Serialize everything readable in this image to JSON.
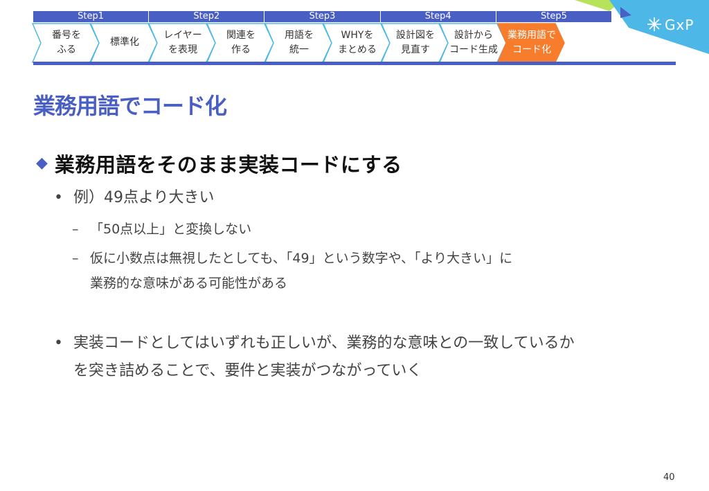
{
  "steps": [
    "Step1",
    "Step2",
    "Step3",
    "Step4",
    "Step5"
  ],
  "process": [
    {
      "line1": "番号を",
      "line2": "ふる"
    },
    {
      "line1": "標準化",
      "line2": ""
    },
    {
      "line1": "レイヤー",
      "line2": "を表現"
    },
    {
      "line1": "関連を",
      "line2": "作る"
    },
    {
      "line1": "用語を",
      "line2": "統一"
    },
    {
      "line1": "WHYを",
      "line2": "まとめる"
    },
    {
      "line1": "設計図を",
      "line2": "見直す"
    },
    {
      "line1": "設計から",
      "line2": "コード生成"
    },
    {
      "line1": "業務用語で",
      "line2": "コード化"
    }
  ],
  "colors": {
    "accent": "#4a5fc4",
    "active": "#f77d2d",
    "chevron_fill": "#ffffff",
    "chevron_border": "#4db8e8"
  },
  "logo": {
    "text": "GxP"
  },
  "title": "業務用語でコード化",
  "heading": "業務用語をそのまま実装コードにする",
  "bullet1": "例）49点より大きい",
  "sub1": "「50点以上」と変換しない",
  "sub2_line1": "仮に小数点は無視したとしても、「49」という数字や、「より大きい」に",
  "sub2_line2": "業務的な意味がある可能性がある",
  "bullet2_line1": "実装コードとしてはいずれも正しいが、業務的な意味との一致しているか",
  "bullet2_line2": "を突き詰めることで、要件と実装がつながっていく",
  "page_number": "40"
}
